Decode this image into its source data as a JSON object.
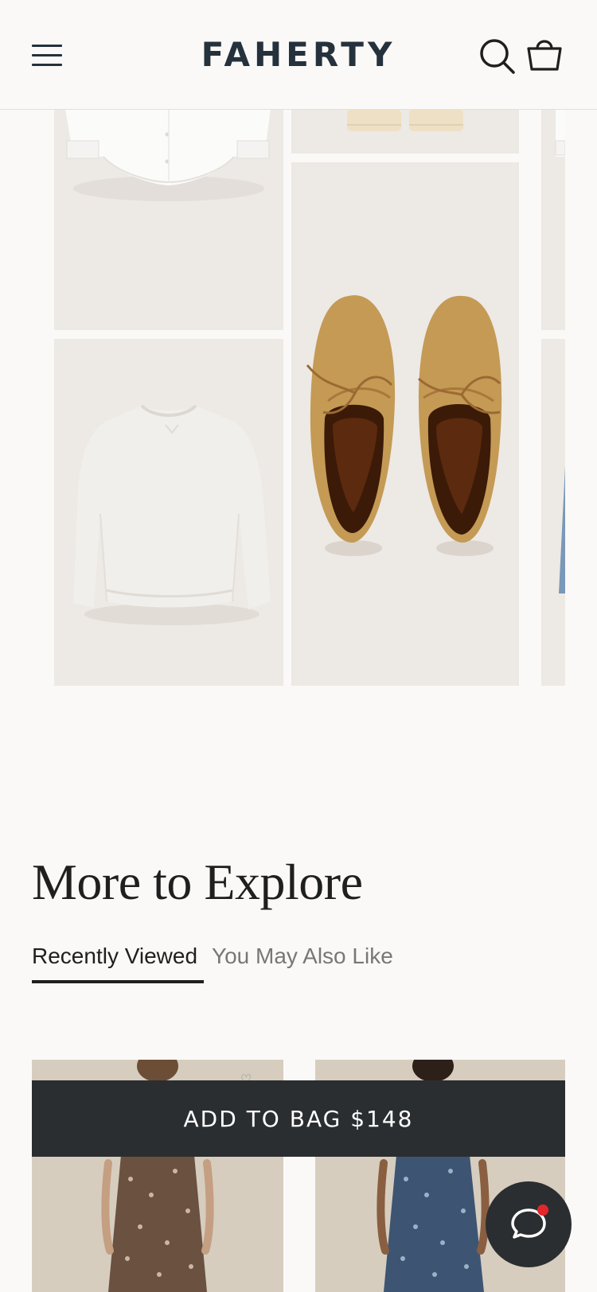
{
  "header": {
    "logo": "FAHERTY",
    "menu_icon": "hamburger-menu-icon",
    "search_icon": "search-icon",
    "bag_icon": "shopping-bag-icon"
  },
  "gallery": {
    "items": [
      "white-oxford-shirt",
      "cream-shorts",
      "tan-suede-moccasins",
      "oatmeal-crewneck-sweatshirt",
      "denim-jeans"
    ]
  },
  "explore": {
    "title": "More to Explore",
    "tabs": [
      {
        "label": "Recently Viewed",
        "active": true
      },
      {
        "label": "You May Also Like",
        "active": false
      }
    ]
  },
  "recommendations": {
    "items": [
      "brown-floral-maxi-dress",
      "blue-floral-maxi-dress"
    ]
  },
  "cta": {
    "add_to_bag": "ADD TO BAG $148"
  },
  "chat": {
    "icon": "chat-bubble-icon",
    "has_notification": true
  },
  "colors": {
    "brand": "#25313c",
    "button_dark": "#2b2e30",
    "tile_bg": "#ede9e4",
    "notification": "#e3262a"
  }
}
